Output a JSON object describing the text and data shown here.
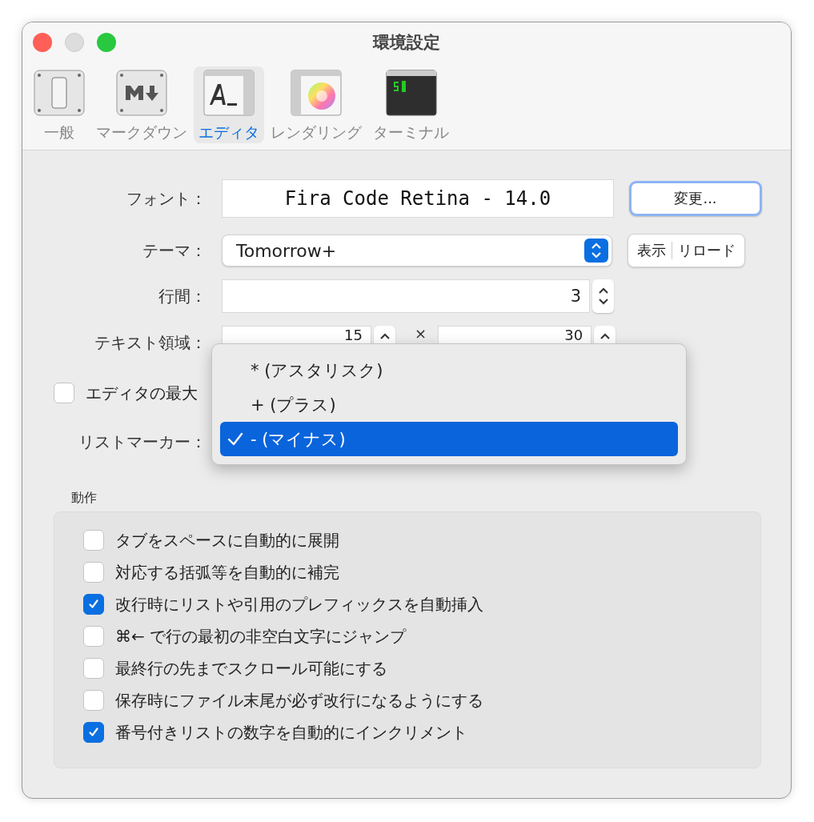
{
  "window": {
    "title": "環境設定"
  },
  "toolbar": [
    {
      "label": "一般",
      "selected": false
    },
    {
      "label": "マークダウン",
      "selected": false
    },
    {
      "label": "エディタ",
      "selected": true
    },
    {
      "label": "レンダリング",
      "selected": false
    },
    {
      "label": "ターミナル",
      "selected": false
    }
  ],
  "font": {
    "label": "フォント：",
    "value": "Fira Code Retina - 14.0",
    "button": "変更..."
  },
  "theme": {
    "label": "テーマ：",
    "value": "Tomorrow+",
    "buttons": [
      "表示",
      "リロード"
    ]
  },
  "line_spacing": {
    "label": "行間：",
    "value": "3"
  },
  "text_area": {
    "label": "テキスト領域：",
    "columns": "15",
    "separator": "×",
    "rows": "30"
  },
  "max_width": {
    "label": "エディタの最大",
    "checked": false
  },
  "list_marker": {
    "label": "リストマーカー：",
    "options": [
      {
        "label": "* (アスタリスク)",
        "selected": false
      },
      {
        "label": "+ (プラス)",
        "selected": false
      },
      {
        "label": "- (マイナス)",
        "selected": true
      }
    ]
  },
  "behavior": {
    "title": "動作",
    "options": [
      {
        "label": "タブをスペースに自動的に展開",
        "checked": false
      },
      {
        "label": "対応する括弧等を自動的に補完",
        "checked": false
      },
      {
        "label": "改行時にリストや引用のプレフィックスを自動挿入",
        "checked": true
      },
      {
        "label": "⌘← で行の最初の非空白文字にジャンプ",
        "checked": false
      },
      {
        "label": "最終行の先までスクロール可能にする",
        "checked": false
      },
      {
        "label": "保存時にファイル末尾が必ず改行になるようにする",
        "checked": false
      },
      {
        "label": "番号付きリストの数字を自動的にインクリメント",
        "checked": true
      }
    ]
  }
}
